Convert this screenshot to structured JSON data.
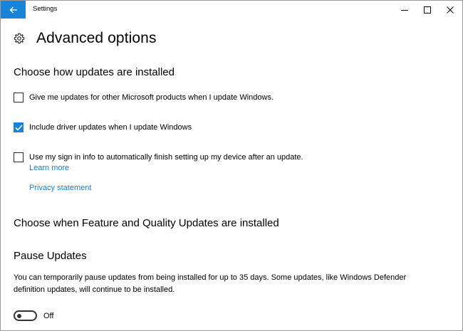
{
  "window": {
    "title": "Settings"
  },
  "page": {
    "title": "Advanced options"
  },
  "install_section": {
    "heading": "Choose how updates are installed",
    "options": [
      {
        "label": "Give me updates for other Microsoft products when I update Windows.",
        "checked": false
      },
      {
        "label": "Include driver updates when I update Windows",
        "checked": true
      },
      {
        "label": "Use my sign in info to automatically finish setting up my device after an update.",
        "checked": false
      }
    ],
    "learn_more": "Learn more",
    "privacy_statement": "Privacy statement"
  },
  "feature_section": {
    "heading": "Choose when Feature and Quality Updates are installed"
  },
  "pause_section": {
    "heading": "Pause Updates",
    "description": "You can temporarily pause updates from being installed for up to 35 days. Some updates, like Windows Defender definition updates, will continue to be installed.",
    "toggle_state": "Off",
    "toggle_on": false
  },
  "colors": {
    "accent": "#1883d7",
    "text": "#000000",
    "background": "#ffffff"
  },
  "icons": {
    "back": "arrow-left-icon",
    "gear": "gear-icon",
    "minimize": "minimize-icon",
    "maximize": "maximize-icon",
    "close": "close-icon",
    "check": "checkmark-icon"
  }
}
